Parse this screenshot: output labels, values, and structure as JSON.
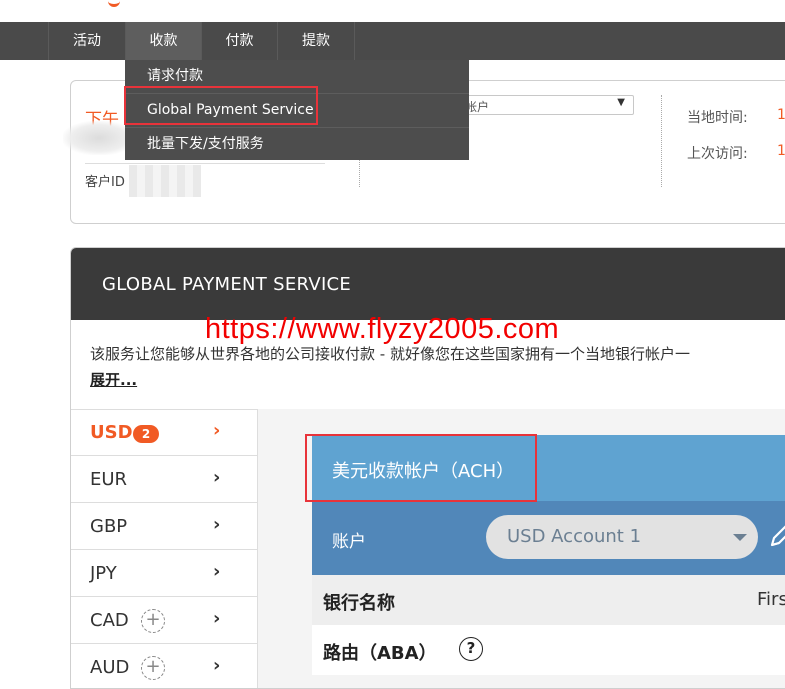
{
  "nav": {
    "items": [
      {
        "label": "活动"
      },
      {
        "label": "收款"
      },
      {
        "label": "付款"
      },
      {
        "label": "提款"
      }
    ],
    "active_index": 1
  },
  "receive_menu": {
    "items": [
      {
        "label": "请求付款"
      },
      {
        "label": "Global Payment Service"
      },
      {
        "label": "批量下发/支付服务"
      }
    ]
  },
  "account_panel": {
    "greeting": "下午",
    "customer_id_label": "客户ID",
    "account_select_text": "帐户",
    "local_time_label": "当地时间:",
    "last_visit_label": "上次访问:",
    "local_time_value": "1",
    "last_visit_value": "1"
  },
  "gps": {
    "title": "GLOBAL PAYMENT SERVICE",
    "description": "该服务让您能够从世界各地的公司接收付款 - 就好像您在这些国家拥有一个当地银行帐户一",
    "expand_label": "展开..."
  },
  "watermark": "https://www.flyzy2005.com",
  "currencies": [
    {
      "code": "USD",
      "badge": "2",
      "active": true,
      "addable": false
    },
    {
      "code": "EUR",
      "badge": "",
      "active": false,
      "addable": false
    },
    {
      "code": "GBP",
      "badge": "",
      "active": false,
      "addable": false
    },
    {
      "code": "JPY",
      "badge": "",
      "active": false,
      "addable": false
    },
    {
      "code": "CAD",
      "badge": "",
      "active": false,
      "addable": true
    },
    {
      "code": "AUD",
      "badge": "",
      "active": false,
      "addable": true
    }
  ],
  "receiving_account": {
    "title": "美元收款帐户（ACH）",
    "account_label": "账户",
    "selected_account": "USD Account 1",
    "bank_name_label": "银行名称",
    "bank_name_value": "Firs",
    "routing_label": "路由（ABA）",
    "help_glyph": "?"
  },
  "icons": {
    "chevron": "›",
    "plus": "+",
    "select_arrow": "▼"
  },
  "colors": {
    "accent_orange": "#f15a24",
    "nav_bg": "#4a4a4a",
    "gps_header_bg": "#3a3a3a",
    "ach_header_bg": "#5fa3d1",
    "account_row_bg": "#5187b9",
    "highlight_red": "#e8333a",
    "watermark_red": "#f20000"
  }
}
